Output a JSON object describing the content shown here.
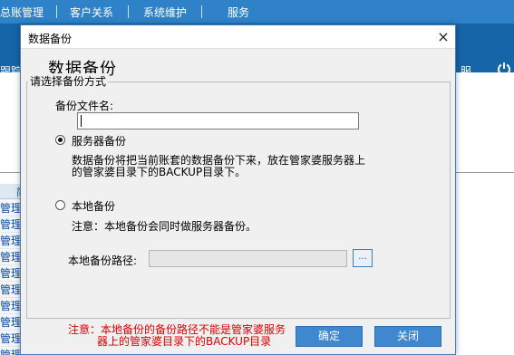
{
  "app": {
    "menus": [
      "总账管理",
      "客户关系",
      "系统维护",
      "服务"
    ],
    "nav_left_label": "跟踪",
    "nav_right_label": "服",
    "sidebar_header": "简",
    "sidebar_rows": [
      "管理员",
      "管理员",
      "管理员",
      "管理员",
      "管理员",
      "管理员",
      "管理员",
      "管理员",
      "管理员",
      "管理员"
    ]
  },
  "dialog": {
    "title": "数据备份",
    "close_symbol": "×",
    "header": "数据备份",
    "group_legend": "请选择备份方式",
    "filename_label": "备份文件名:",
    "filename_value": "",
    "server_option_label": "服务器备份",
    "server_option_checked": true,
    "server_description_line1": "数据备份将把当前账套的数据备份下来，放在管家婆服务器上",
    "server_description_line2": "的管家婆目录下的BACKUP目录下。",
    "local_option_label": "本地备份",
    "local_option_checked": false,
    "local_note": "注意：本地备份会同时做服务器备份。",
    "local_path_label": "本地备份路径:",
    "local_path_value": "",
    "browse_label": "...",
    "warning_line1": "注意：本地备份的备份路径不能是管家婆服务",
    "warning_line2": "器上的管家婆目录下的BACKUP目录",
    "ok_label": "确定",
    "close_label": "关闭"
  },
  "colors": {
    "topbar": "#2f82c8",
    "navbar": "#1565a8",
    "button": "#3f87cf",
    "warning": "#e00000"
  }
}
